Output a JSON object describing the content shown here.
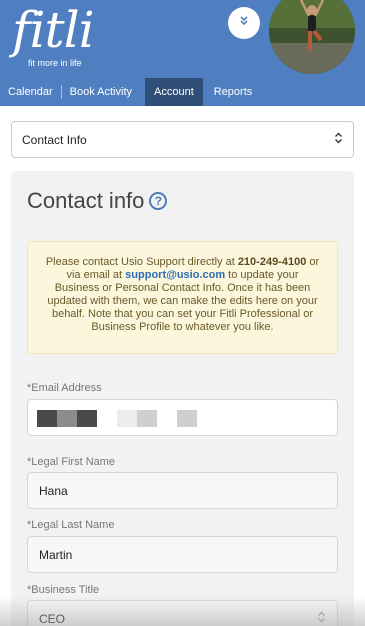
{
  "brand": {
    "logo_word": "fitli",
    "tagline": "fit more in life"
  },
  "header": {
    "tabs": [
      {
        "label": "Calendar",
        "active": false
      },
      {
        "label": "Book Activity",
        "active": false
      },
      {
        "label": "Account",
        "active": true
      },
      {
        "label": "Reports",
        "active": false
      }
    ]
  },
  "section_select": {
    "value": "Contact Info"
  },
  "card": {
    "title": "Contact info",
    "help_glyph": "?",
    "notice": {
      "prefix": "Please contact Usio Support directly at ",
      "phone": "210-249-4100",
      "middle": " or via email at ",
      "email": "support@usio.com",
      "suffix": " to update your Business or Personal Contact Info. Once it has been updated with them, we can make the edits here on your behalf. Note that you can set your Fitli Professional or Business Profile to whatever you like."
    },
    "fields": {
      "email": {
        "label": "*Email Address",
        "value": ""
      },
      "first_name": {
        "label": "*Legal First Name",
        "value": "Hana"
      },
      "last_name": {
        "label": "*Legal Last Name",
        "value": "Martin"
      },
      "business_title": {
        "label": "*Business Title",
        "value": "CEO"
      }
    }
  },
  "colors": {
    "header_blue": "#4f7fc0",
    "active_tab": "#2f4f78",
    "notice_bg": "#fcf6dc",
    "link_blue": "#2d6db5"
  },
  "icons": [
    "chevron-double-down-icon",
    "select-updown-icon",
    "help-circle-icon"
  ]
}
